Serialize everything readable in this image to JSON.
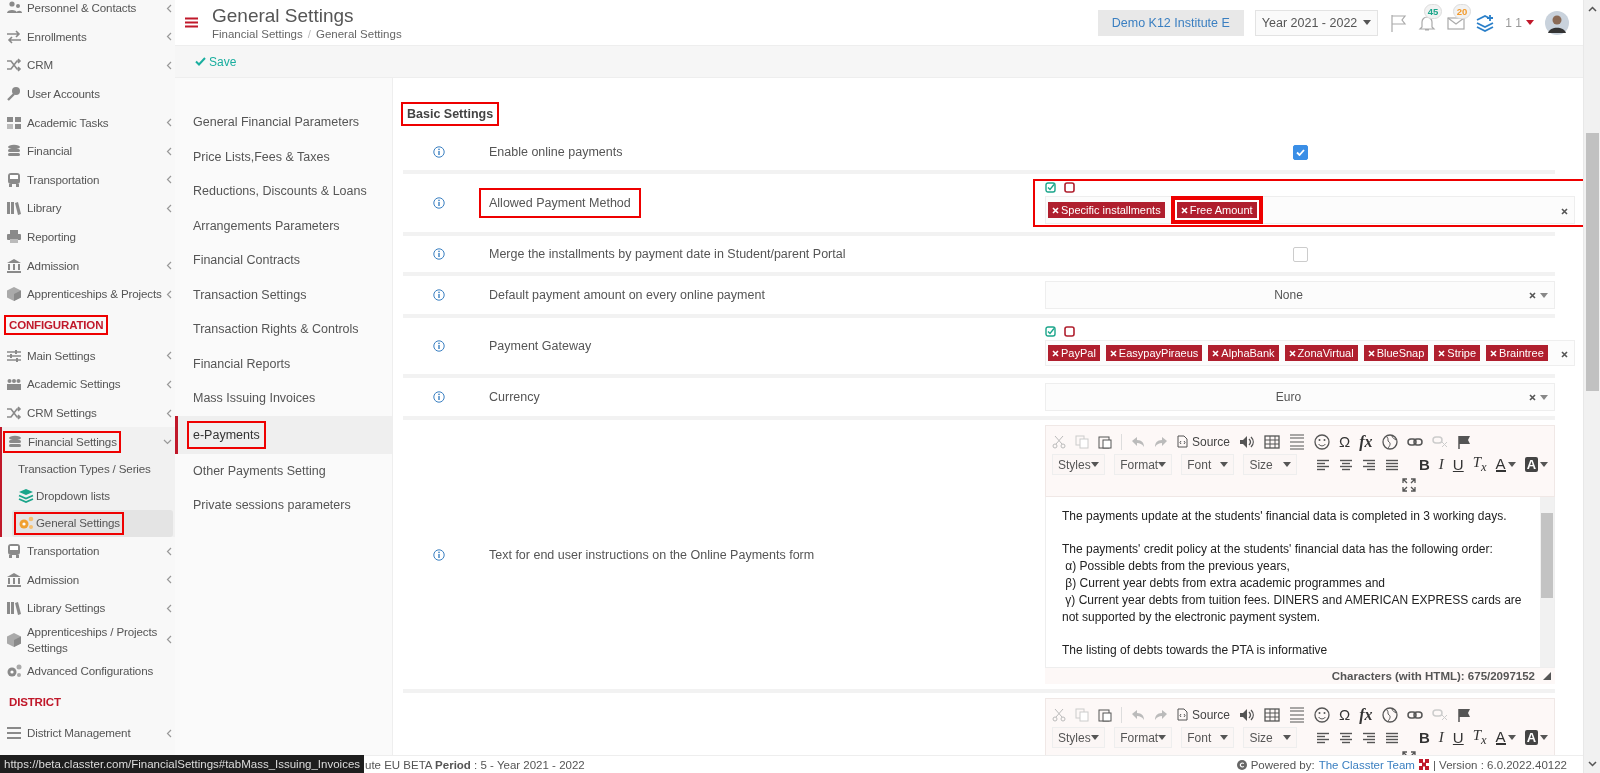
{
  "sidebar": {
    "items": [
      {
        "kind": "item",
        "label": "Personnel & Contacts",
        "expandable": true,
        "expanded": false,
        "highlighted": false
      },
      {
        "kind": "item",
        "label": "Enrollments",
        "expandable": true,
        "expanded": false,
        "highlighted": false
      },
      {
        "kind": "item",
        "label": "CRM",
        "expandable": true,
        "expanded": false,
        "highlighted": false
      },
      {
        "kind": "item",
        "label": "User Accounts",
        "expandable": false,
        "highlighted": false
      },
      {
        "kind": "item",
        "label": "Academic Tasks",
        "expandable": true,
        "expanded": false,
        "highlighted": false
      },
      {
        "kind": "item",
        "label": "Financial",
        "expandable": true,
        "expanded": false,
        "highlighted": false
      },
      {
        "kind": "item",
        "label": "Transportation",
        "expandable": true,
        "expanded": false,
        "highlighted": false
      },
      {
        "kind": "item",
        "label": "Library",
        "expandable": true,
        "expanded": false,
        "highlighted": false
      },
      {
        "kind": "item",
        "label": "Reporting",
        "expandable": false,
        "highlighted": false
      },
      {
        "kind": "item",
        "label": "Admission",
        "expandable": true,
        "expanded": false,
        "highlighted": false
      },
      {
        "kind": "item",
        "label": "Apprenticeships & Projects",
        "expandable": true,
        "expanded": false,
        "highlighted": false
      },
      {
        "kind": "section",
        "label": "CONFIGURATION",
        "highlighted": true
      },
      {
        "kind": "item",
        "label": "Main Settings",
        "expandable": true,
        "expanded": false,
        "highlighted": false
      },
      {
        "kind": "item",
        "label": "Academic Settings",
        "expandable": true,
        "expanded": false,
        "highlighted": false
      },
      {
        "kind": "item",
        "label": "CRM Settings",
        "expandable": true,
        "expanded": false,
        "highlighted": false
      },
      {
        "kind": "item",
        "label": "Financial Settings",
        "expandable": true,
        "expanded": true,
        "highlighted": true,
        "children": [
          {
            "label": "Transaction Types / Series",
            "selected": false,
            "highlighted": false
          },
          {
            "label": "Dropdown lists",
            "selected": false,
            "highlighted": false
          },
          {
            "label": "General Settings",
            "selected": true,
            "highlighted": true
          }
        ]
      },
      {
        "kind": "item",
        "label": "Transportation",
        "expandable": true,
        "expanded": false,
        "highlighted": false
      },
      {
        "kind": "item",
        "label": "Admission",
        "expandable": true,
        "expanded": false,
        "highlighted": false
      },
      {
        "kind": "item",
        "label": "Library Settings",
        "expandable": true,
        "expanded": false,
        "highlighted": false
      },
      {
        "kind": "item",
        "label": "Apprenticeships / Projects Settings",
        "expandable": true,
        "expanded": false,
        "highlighted": false
      },
      {
        "kind": "item",
        "label": "Advanced Configurations",
        "expandable": false,
        "highlighted": false
      },
      {
        "kind": "section",
        "label": "DISTRICT",
        "highlighted": false
      },
      {
        "kind": "item",
        "label": "District Management",
        "expandable": true,
        "expanded": false,
        "highlighted": false
      }
    ]
  },
  "header": {
    "title": "General Settings",
    "breadcrumb": [
      "Financial Settings",
      "General Settings"
    ],
    "breadcrumb_separator": "/",
    "institute": "Demo K12 Institute E",
    "year": "Year 2021 - 2022",
    "notifications": "45",
    "messages": "20",
    "user": "1 1"
  },
  "actions": {
    "save": "Save"
  },
  "subnav": {
    "items": [
      {
        "label": "General Financial Parameters",
        "selected": false,
        "highlighted": false
      },
      {
        "label": "Price Lists,Fees & Taxes",
        "selected": false,
        "highlighted": false
      },
      {
        "label": "Reductions, Discounts & Loans",
        "selected": false,
        "highlighted": false
      },
      {
        "label": "Arrangements Parameters",
        "selected": false,
        "highlighted": false
      },
      {
        "label": "Financial Contracts",
        "selected": false,
        "highlighted": false
      },
      {
        "label": "Transaction Settings",
        "selected": false,
        "highlighted": false
      },
      {
        "label": "Transaction Rights & Controls",
        "selected": false,
        "highlighted": false
      },
      {
        "label": "Financial Reports",
        "selected": false,
        "highlighted": false
      },
      {
        "label": "Mass Issuing Invoices",
        "selected": false,
        "highlighted": false
      },
      {
        "label": "e-Payments",
        "selected": true,
        "highlighted": true
      },
      {
        "label": "Other Payments Setting",
        "selected": false,
        "highlighted": false
      },
      {
        "label": "Private sessions parameters",
        "selected": false,
        "highlighted": false
      }
    ]
  },
  "panel": {
    "heading": "Basic Settings",
    "heading_highlighted": true,
    "rows": [
      {
        "kind": "checkbox",
        "label": "Enable online payments",
        "label_highlighted": false,
        "checked": true
      },
      {
        "kind": "tags",
        "label": "Allowed Payment Method",
        "label_highlighted": true,
        "field_highlighted": true,
        "tags": [
          {
            "label": "Specific installments",
            "highlighted": false
          },
          {
            "label": "Free Amount",
            "highlighted": true
          }
        ]
      },
      {
        "kind": "checkbox",
        "label": "Merge the installments by payment date in Student/parent Portal",
        "label_highlighted": false,
        "checked": false
      },
      {
        "kind": "select",
        "label": "Default payment amount on every online payment",
        "label_highlighted": false,
        "value": "None"
      },
      {
        "kind": "tags",
        "label": "Payment Gateway",
        "label_highlighted": false,
        "field_highlighted": false,
        "tags": [
          {
            "label": "PayPal",
            "highlighted": false
          },
          {
            "label": "EasypayPiraeus",
            "highlighted": false
          },
          {
            "label": "AlphaBank",
            "highlighted": false
          },
          {
            "label": "ZonaVirtual",
            "highlighted": false
          },
          {
            "label": "BlueSnap",
            "highlighted": false
          },
          {
            "label": "Stripe",
            "highlighted": false
          },
          {
            "label": "Braintree",
            "highlighted": false
          }
        ]
      },
      {
        "kind": "select",
        "label": "Currency",
        "label_highlighted": false,
        "value": "Euro"
      },
      {
        "kind": "editor",
        "label": "Text for end user instructions on the Online Payments form",
        "label_highlighted": false,
        "editor": {
          "source": "Source",
          "glyphs": [
            "Ω",
            "fx"
          ],
          "dropdowns": [
            "Styles",
            "Format",
            "Font",
            "Size"
          ],
          "format_glyphs": [
            "B",
            "I",
            "U",
            "T$_{x}$",
            "A",
            "A"
          ],
          "paragraphs": [
            [
              "The payments update at the students' financial data is completed in 3 working days."
            ],
            [
              "The payments' credit policy at the students' financial data has the following order:",
              " α) Possible debts from the previous years,",
              " β) Current year debts from extra academic programmes and",
              " γ) Current year debts from tuition fees. DINERS and AMERICAN EXPRESS cards are not supported by the electronic payment system."
            ],
            [
              "The listing of debts towards the PTA is informative"
            ]
          ],
          "counter": "Characters (with HTML): 675/2097152"
        }
      },
      {
        "kind": "editor",
        "editor": {
          "source": "Source",
          "glyphs": [
            "Ω",
            "fx"
          ],
          "dropdowns": [
            "Styles",
            "Format",
            "Font",
            "Size"
          ],
          "format_glyphs": [
            "B",
            "I",
            "U",
            "T$_{x}$",
            "A",
            "A"
          ]
        }
      }
    ]
  },
  "footer": {
    "institute_period": "ute EU BETA **Period** : 5 - Year 2021 - 2022",
    "powered_by": "Powered by:",
    "team": "The Classter Team",
    "version": "| Version : 6.0.2022.40122",
    "url_tooltip": "https://beta.classter.com/FinancialSettings#tabMass_Issuing_Invoices"
  }
}
